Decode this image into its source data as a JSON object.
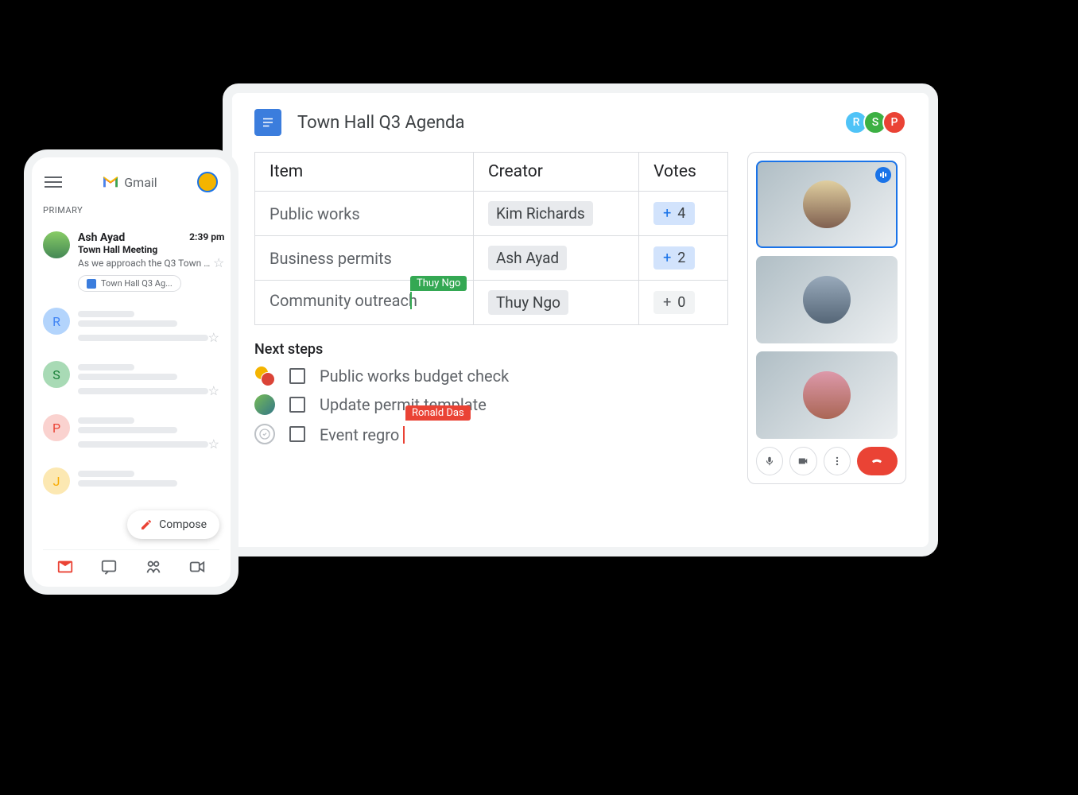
{
  "laptop": {
    "doc_title": "Town Hall Q3 Agenda",
    "collaborators": [
      {
        "initial": "R",
        "color": "chip-r"
      },
      {
        "initial": "S",
        "color": "chip-s"
      },
      {
        "initial": "P",
        "color": "chip-p"
      }
    ],
    "table": {
      "headers": {
        "item": "Item",
        "creator": "Creator",
        "votes": "Votes"
      },
      "rows": [
        {
          "item": "Public works",
          "creator": "Kim Richards",
          "votes": "4"
        },
        {
          "item": "Business permits",
          "creator": "Ash Ayad",
          "votes": "2"
        },
        {
          "item": "Community outreach",
          "creator": "Thuy Ngo",
          "votes": "0"
        }
      ]
    },
    "cursor_green": "Thuy Ngo",
    "cursor_red": "Ronald Das",
    "next_steps_heading": "Next steps",
    "tasks": [
      {
        "text": "Public works budget check"
      },
      {
        "text": "Update permit template"
      },
      {
        "text": "Event regro"
      }
    ]
  },
  "phone": {
    "app_name": "Gmail",
    "primary_label": "PRIMARY",
    "email": {
      "sender": "Ash Ayad",
      "time": "2:39 pm",
      "subject": "Town Hall Meeting",
      "preview": "As we approach the Q3 Town Ha...",
      "attachment": "Town Hall Q3 Ag..."
    },
    "skeleton_initials": [
      "R",
      "S",
      "P",
      "J"
    ],
    "compose_label": "Compose"
  }
}
